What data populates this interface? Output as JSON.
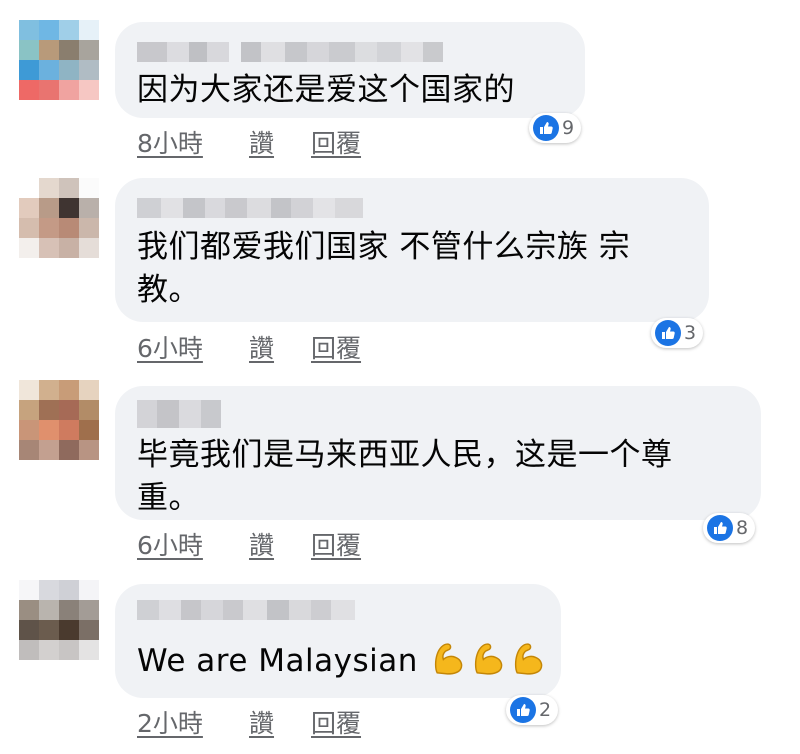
{
  "comments": [
    {
      "text_lines": [
        "因为大家还是爱这个国家的"
      ],
      "time": "8小時",
      "like_label": "讚",
      "reply_label": "回覆",
      "reactions": "9",
      "avatar_colors": [
        "#80bfe0",
        "#6fb7e4",
        "#a0cfe8",
        "#e6f1f8",
        "#8ac3c5",
        "#b89a7a",
        "#8a7e6e",
        "#a8a49d",
        "#3e9ad6",
        "#6bb1de",
        "#8fb4c4",
        "#b0bcc4",
        "#ee6966",
        "#e97470",
        "#f0a3a0",
        "#f6c7c3"
      ]
    },
    {
      "text_lines": [
        "我们都爱我们国家 不管什么宗族 宗",
        "教。"
      ],
      "time": "6小時",
      "like_label": "讚",
      "reply_label": "回覆",
      "reactions": "3",
      "avatar_colors": [
        "#ffffff",
        "#e4d8ce",
        "#cfc3bb",
        "#fbfbfb",
        "#e2cbbd",
        "#b89b88",
        "#3f3431",
        "#b9b0aa",
        "#d5bdae",
        "#c49a86",
        "#b88a76",
        "#cbb7ab",
        "#f3efec",
        "#d7c1b6",
        "#c8b1a5",
        "#e5ddd8"
      ]
    },
    {
      "text_lines": [
        "毕竟我们是马来西亚人民，这是一个尊",
        "重。"
      ],
      "time": "6小時",
      "like_label": "讚",
      "reply_label": "回覆",
      "reactions": "8",
      "avatar_colors": [
        "#f0e6da",
        "#d1b08e",
        "#c89c78",
        "#e6d3bf",
        "#c6a37e",
        "#9f7055",
        "#a66a56",
        "#b28c67",
        "#c99578",
        "#e0906d",
        "#cf7b5f",
        "#9f6f4c",
        "#a78676",
        "#c3a090",
        "#8f6a5d",
        "#b89483"
      ]
    },
    {
      "text_lines": [
        "We are Malaysian"
      ],
      "time": "2小時",
      "like_label": "讚",
      "reply_label": "回覆",
      "reactions": "2",
      "avatar_colors": [
        "#f6f6f8",
        "#d8d9de",
        "#cfd0d6",
        "#f4f4f7",
        "#9a8e82",
        "#b9b4ae",
        "#8a8179",
        "#a39c96",
        "#5f5349",
        "#6b5c4e",
        "#4a3a2e",
        "#7b6f66",
        "#c0bdbc",
        "#d3d0cf",
        "#c8c5c4",
        "#e4e3e3"
      ]
    }
  ],
  "icons": {
    "like": "thumbs-up-icon",
    "emoji": "flexed-biceps-icon"
  },
  "colors": {
    "bubble": "#f0f2f5",
    "like_blue": "#1b74e4",
    "meta_gray": "#65676b"
  }
}
